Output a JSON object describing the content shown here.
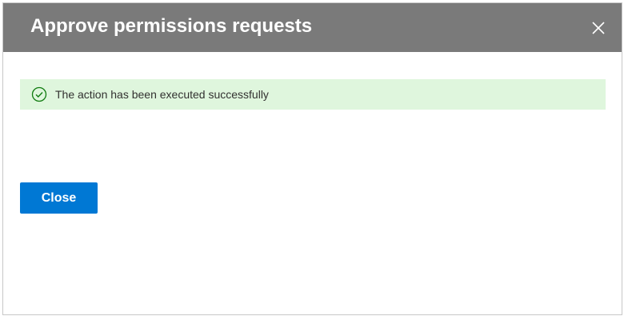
{
  "dialog": {
    "title": "Approve permissions requests",
    "close_icon": "close-icon"
  },
  "notification": {
    "icon": "success-checkmark-icon",
    "message": "The action has been executed successfully",
    "background_color": "#dff6dd",
    "icon_color": "#107c10"
  },
  "actions": {
    "close_label": "Close",
    "accent_color": "#0078d4"
  },
  "colors": {
    "header_background": "#7a7a7a"
  }
}
